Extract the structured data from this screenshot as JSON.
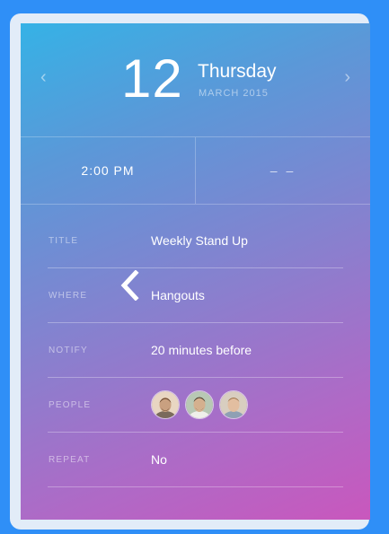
{
  "date": {
    "day": "12",
    "weekday": "Thursday",
    "month_year": "MARCH 2015",
    "prev_icon": "‹",
    "next_icon": "›"
  },
  "time": {
    "start": "2:00 PM",
    "end": "– –"
  },
  "fields": [
    {
      "label": "TITLE",
      "value": "Weekly Stand Up"
    },
    {
      "label": "WHERE",
      "value": "Hangouts"
    },
    {
      "label": "NOTIFY",
      "value": "20 minutes before"
    },
    {
      "label": "PEOPLE",
      "value": ""
    },
    {
      "label": "REPEAT",
      "value": "No"
    }
  ],
  "people": [
    {
      "icon": "avatar-person-1",
      "skin": "#c9a080",
      "hair": "#5a3a22",
      "bg": "#e8d6c2"
    },
    {
      "icon": "avatar-person-2",
      "skin": "#d4b08e",
      "hair": "#3a2a1c",
      "bg": "#b8c8b4"
    },
    {
      "icon": "avatar-person-3",
      "skin": "#e2bea0",
      "hair": "#9a7048",
      "bg": "#d8cec0"
    }
  ]
}
